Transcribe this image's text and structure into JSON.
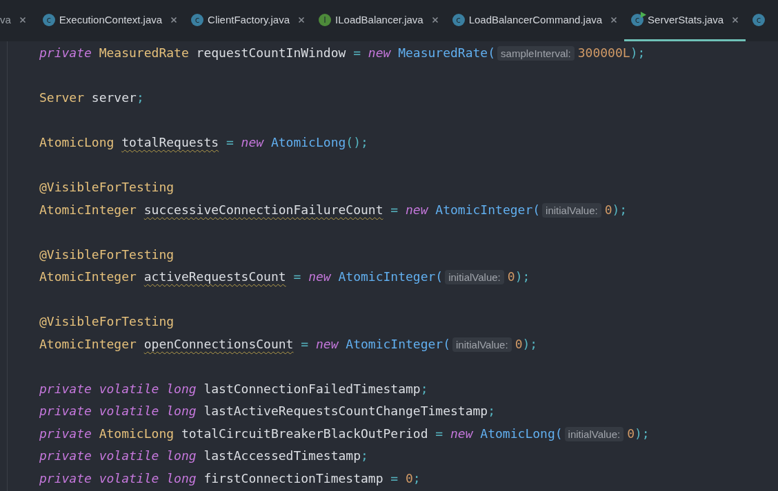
{
  "tabs": [
    {
      "label": "va",
      "run_marker": false,
      "selected": false,
      "closable": true
    },
    {
      "label": "ExecutionContext.java",
      "icon": {
        "letter": "c",
        "color": "#3a7fa0"
      },
      "run_marker": false,
      "selected": false,
      "closable": true
    },
    {
      "label": "ClientFactory.java",
      "icon": {
        "letter": "c",
        "color": "#3a7fa0"
      },
      "run_marker": false,
      "selected": false,
      "closable": true
    },
    {
      "label": "ILoadBalancer.java",
      "icon": {
        "letter": "I",
        "color": "#4d8a3a"
      },
      "run_marker": false,
      "selected": false,
      "closable": true
    },
    {
      "label": "LoadBalancerCommand.java",
      "icon": {
        "letter": "c",
        "color": "#3a7fa0"
      },
      "run_marker": false,
      "selected": false,
      "closable": true
    },
    {
      "label": "ServerStats.java",
      "icon": {
        "letter": "c",
        "color": "#3a7fa0"
      },
      "run_marker": true,
      "selected": true,
      "closable": true
    },
    {
      "icon": {
        "letter": "c",
        "color": "#3a7fa0"
      },
      "run_marker": false,
      "selected": false,
      "closable": false
    }
  ],
  "code": {
    "lines": [
      {
        "kind": "code",
        "tokens": [
          {
            "kind": "kw",
            "text": "private"
          },
          {
            "kind": "type",
            "text": "MeasuredRate"
          },
          {
            "kind": "id",
            "text": "requestCountInWindow"
          },
          {
            "kind": "op",
            "text": "="
          },
          {
            "kind": "kw",
            "text": "new"
          },
          {
            "kind": "call",
            "text": "MeasuredRate("
          },
          {
            "kind": "hint",
            "text": "sampleInterval:"
          },
          {
            "kind": "num",
            "text": "300000L"
          },
          {
            "kind": "op",
            "text": ");"
          }
        ]
      },
      {
        "kind": "blank"
      },
      {
        "kind": "code",
        "tokens": [
          {
            "kind": "type",
            "text": "Server"
          },
          {
            "kind": "id",
            "text": "server"
          },
          {
            "kind": "op",
            "text": ";"
          }
        ]
      },
      {
        "kind": "blank"
      },
      {
        "kind": "code",
        "tokens": [
          {
            "kind": "type",
            "text": "AtomicLong"
          },
          {
            "kind": "warn",
            "text": "totalRequests"
          },
          {
            "kind": "op",
            "text": "="
          },
          {
            "kind": "kw",
            "text": "new"
          },
          {
            "kind": "call",
            "text": "AtomicLong"
          },
          {
            "kind": "op",
            "text": "();"
          }
        ]
      },
      {
        "kind": "blank"
      },
      {
        "kind": "code",
        "tokens": [
          {
            "kind": "ann",
            "text": "@VisibleForTesting"
          }
        ]
      },
      {
        "kind": "code",
        "tokens": [
          {
            "kind": "type",
            "text": "AtomicInteger"
          },
          {
            "kind": "warn",
            "text": "successiveConnectionFailureCount"
          },
          {
            "kind": "op",
            "text": "="
          },
          {
            "kind": "kw",
            "text": "new"
          },
          {
            "kind": "call",
            "text": "AtomicInteger("
          },
          {
            "kind": "hint",
            "text": "initialValue:"
          },
          {
            "kind": "num",
            "text": "0"
          },
          {
            "kind": "op",
            "text": ");"
          }
        ]
      },
      {
        "kind": "blank"
      },
      {
        "kind": "code",
        "tokens": [
          {
            "kind": "ann",
            "text": "@VisibleForTesting"
          }
        ]
      },
      {
        "kind": "code",
        "tokens": [
          {
            "kind": "type",
            "text": "AtomicInteger"
          },
          {
            "kind": "warn",
            "text": "activeRequestsCount"
          },
          {
            "kind": "op",
            "text": "="
          },
          {
            "kind": "kw",
            "text": "new"
          },
          {
            "kind": "call",
            "text": "AtomicInteger("
          },
          {
            "kind": "hint",
            "text": "initialValue:"
          },
          {
            "kind": "num",
            "text": "0"
          },
          {
            "kind": "op",
            "text": ");"
          }
        ]
      },
      {
        "kind": "blank"
      },
      {
        "kind": "code",
        "tokens": [
          {
            "kind": "ann",
            "text": "@VisibleForTesting"
          }
        ]
      },
      {
        "kind": "code",
        "tokens": [
          {
            "kind": "type",
            "text": "AtomicInteger"
          },
          {
            "kind": "warn",
            "text": "openConnectionsCount"
          },
          {
            "kind": "op",
            "text": "="
          },
          {
            "kind": "kw",
            "text": "new"
          },
          {
            "kind": "call",
            "text": "AtomicInteger("
          },
          {
            "kind": "hint",
            "text": "initialValue:"
          },
          {
            "kind": "num",
            "text": "0"
          },
          {
            "kind": "op",
            "text": ");"
          }
        ]
      },
      {
        "kind": "blank"
      },
      {
        "kind": "code",
        "tokens": [
          {
            "kind": "kw",
            "text": "private"
          },
          {
            "kind": "kw",
            "text": "volatile"
          },
          {
            "kind": "kw",
            "text": "long"
          },
          {
            "kind": "id",
            "text": "lastConnectionFailedTimestamp"
          },
          {
            "kind": "op",
            "text": ";"
          }
        ]
      },
      {
        "kind": "code",
        "tokens": [
          {
            "kind": "kw",
            "text": "private"
          },
          {
            "kind": "kw",
            "text": "volatile"
          },
          {
            "kind": "kw",
            "text": "long"
          },
          {
            "kind": "id",
            "text": "lastActiveRequestsCountChangeTimestamp"
          },
          {
            "kind": "op",
            "text": ";"
          }
        ]
      },
      {
        "kind": "code",
        "tokens": [
          {
            "kind": "kw",
            "text": "private"
          },
          {
            "kind": "type",
            "text": "AtomicLong"
          },
          {
            "kind": "id",
            "text": "totalCircuitBreakerBlackOutPeriod"
          },
          {
            "kind": "op",
            "text": "="
          },
          {
            "kind": "kw",
            "text": "new"
          },
          {
            "kind": "call",
            "text": "AtomicLong("
          },
          {
            "kind": "hint",
            "text": "initialValue:"
          },
          {
            "kind": "num",
            "text": "0"
          },
          {
            "kind": "op",
            "text": ");"
          }
        ]
      },
      {
        "kind": "code",
        "tokens": [
          {
            "kind": "kw",
            "text": "private"
          },
          {
            "kind": "kw",
            "text": "volatile"
          },
          {
            "kind": "kw",
            "text": "long"
          },
          {
            "kind": "id",
            "text": "lastAccessedTimestamp"
          },
          {
            "kind": "op",
            "text": ";"
          }
        ]
      },
      {
        "kind": "code",
        "tokens": [
          {
            "kind": "kw",
            "text": "private"
          },
          {
            "kind": "kw",
            "text": "volatile"
          },
          {
            "kind": "kw",
            "text": "long"
          },
          {
            "kind": "id",
            "text": "firstConnectionTimestamp"
          },
          {
            "kind": "op",
            "text": "="
          },
          {
            "kind": "num",
            "text": "0"
          },
          {
            "kind": "op",
            "text": ";"
          }
        ]
      }
    ]
  }
}
